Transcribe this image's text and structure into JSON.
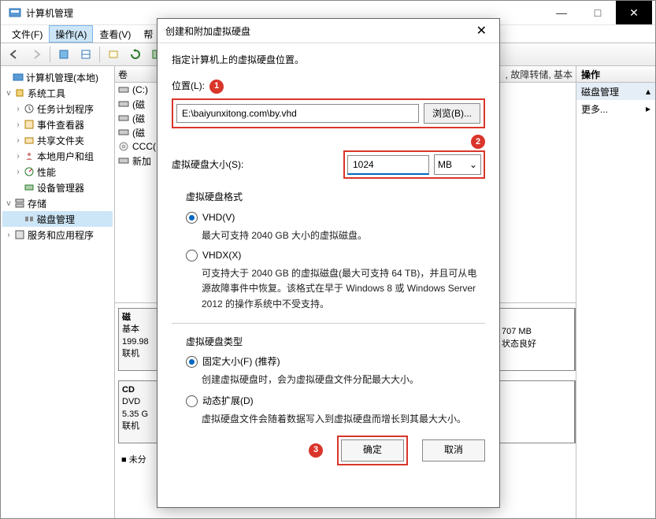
{
  "window": {
    "title": "计算机管理",
    "min": "—",
    "max": "□",
    "close": "✕"
  },
  "menu": {
    "file": "文件(F)",
    "action": "操作(A)",
    "view": "查看(V)",
    "help": "帮"
  },
  "tree": {
    "root": "计算机管理(本地)",
    "sys_tools": "系统工具",
    "task_sched": "任务计划程序",
    "event_viewer": "事件查看器",
    "shared_folders": "共享文件夹",
    "local_users": "本地用户和组",
    "performance": "性能",
    "device_mgr": "设备管理器",
    "storage": "存储",
    "disk_mgmt": "磁盘管理",
    "services_apps": "服务和应用程序"
  },
  "volumes": {
    "header": "卷",
    "items": [
      "(C:)",
      "(磁",
      "(磁",
      "(磁",
      "CCC(",
      "新加"
    ],
    "top_right_fragment": ", 故障转储, 基本"
  },
  "disks": {
    "disk0": {
      "label": "磁",
      "type": "基本",
      "size": "199.98",
      "status": "联机"
    },
    "disk0_part": {
      "size": "707 MB",
      "status": "状态良好"
    },
    "cd": {
      "label": "CD",
      "type": "DVD",
      "size": "5.35 G",
      "status": "联机"
    },
    "footer": "未分"
  },
  "right_panel": {
    "header": "操作",
    "item1": "磁盘管理",
    "item2": "更多...",
    "arrow_up": "▴",
    "arrow_right": "▸"
  },
  "dialog": {
    "title": "创建和附加虚拟硬盘",
    "intro": "指定计算机上的虚拟硬盘位置。",
    "location_label": "位置(L):",
    "location_value": "E:\\baiyunxitong.com\\by.vhd",
    "browse": "浏览(B)...",
    "size_label": "虚拟硬盘大小(S):",
    "size_value": "1024",
    "size_unit": "MB",
    "format_title": "虚拟硬盘格式",
    "vhd_label": "VHD(V)",
    "vhd_desc": "最大可支持 2040 GB 大小的虚拟磁盘。",
    "vhdx_label": "VHDX(X)",
    "vhdx_desc": "可支持大于 2040 GB 的虚拟磁盘(最大可支持 64 TB)，并且可从电源故障事件中恢复。该格式在早于 Windows 8 或 Windows Server 2012 的操作系统中不受支持。",
    "type_title": "虚拟硬盘类型",
    "fixed_label": "固定大小(F) (推荐)",
    "fixed_desc": "创建虚拟硬盘时，会为虚拟硬盘文件分配最大大小。",
    "dynamic_label": "动态扩展(D)",
    "dynamic_desc": "虚拟硬盘文件会随着数据写入到虚拟硬盘而增长到其最大大小。",
    "ok": "确定",
    "cancel": "取消",
    "marker1": "1",
    "marker2": "2",
    "marker3": "3",
    "chevron": "⌄",
    "close_x": "✕"
  }
}
